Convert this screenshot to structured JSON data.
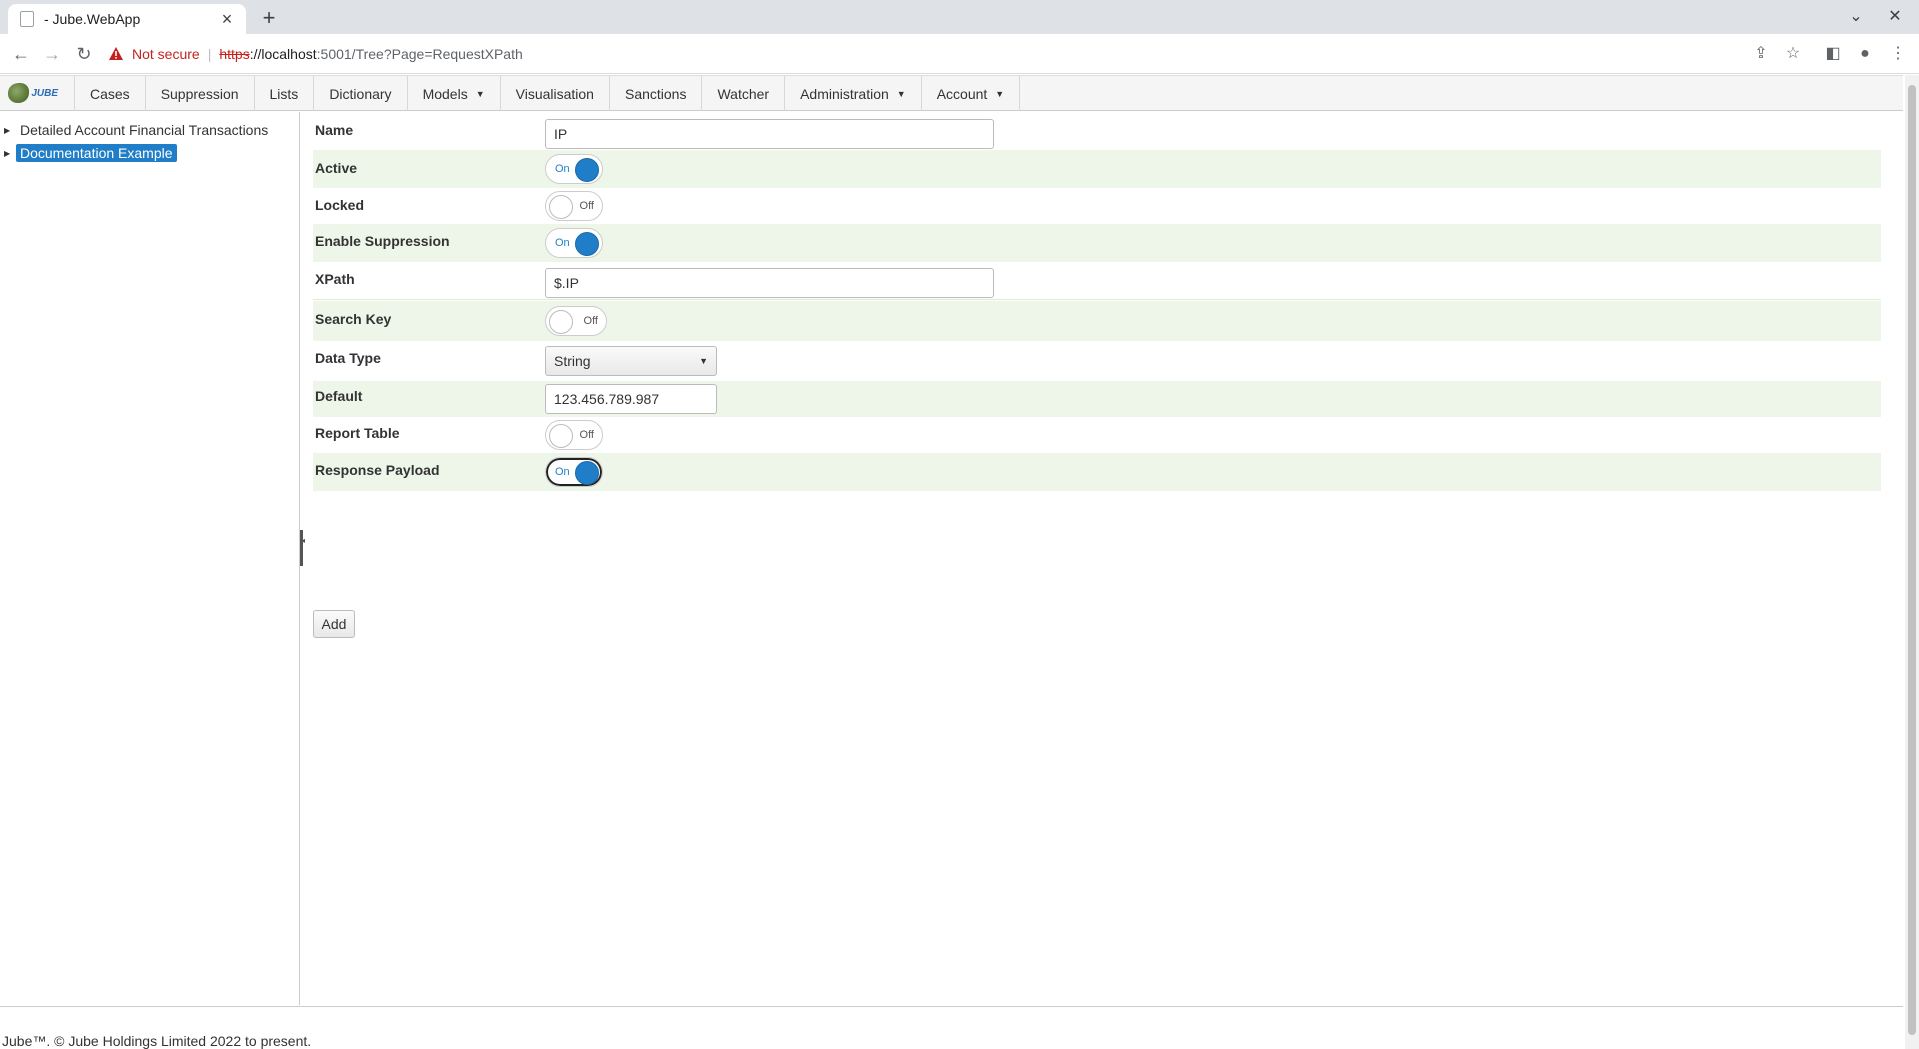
{
  "browser": {
    "tab_title": "- Jube.WebApp",
    "not_secure": "Not secure",
    "url_scheme": "https",
    "url_host": "://localhost",
    "url_path": ":5001/Tree?Page=RequestXPath"
  },
  "nav": {
    "items": [
      "Cases",
      "Suppression",
      "Lists",
      "Dictionary",
      "Models",
      "Visualisation",
      "Sanctions",
      "Watcher",
      "Administration",
      "Account"
    ],
    "logo_text": "JUBE"
  },
  "tree": {
    "items": [
      "Detailed Account Financial Transactions",
      "Documentation Example"
    ]
  },
  "form": {
    "name_label": "Name",
    "name_value": "IP",
    "active_label": "Active",
    "active_state": "On",
    "locked_label": "Locked",
    "locked_state": "Off",
    "suppression_label": "Enable Suppression",
    "suppression_state": "On",
    "xpath_label": "XPath",
    "xpath_value": "$.IP",
    "search_key_label": "Search Key",
    "search_key_state": "Off",
    "data_type_label": "Data Type",
    "data_type_value": "String",
    "default_label": "Default",
    "default_value": "123.456.789.987",
    "report_table_label": "Report Table",
    "report_table_state": "Off",
    "response_payload_label": "Response Payload",
    "response_payload_state": "On",
    "add_button": "Add"
  },
  "footer": {
    "text": "Jube™. © Jube Holdings Limited 2022 to present."
  },
  "colors": {
    "accent": "#1f7ec7",
    "alt_row": "#eef6ea"
  }
}
